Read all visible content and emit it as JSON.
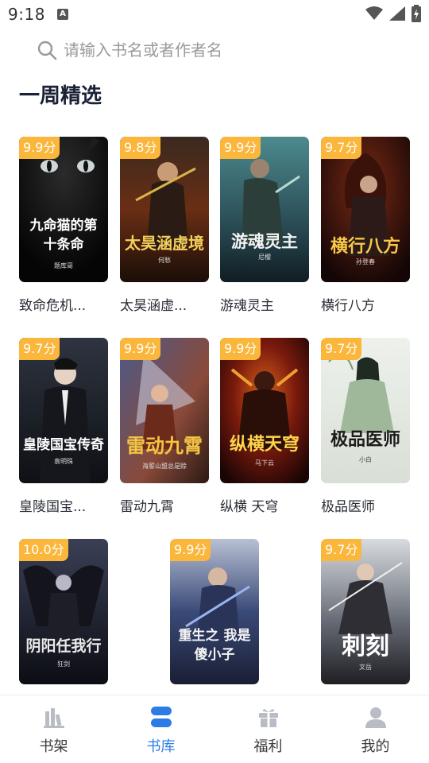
{
  "status": {
    "time": "9:18"
  },
  "search": {
    "placeholder": "请输入书名或者作者名"
  },
  "section": {
    "title": "一周精选"
  },
  "books": [
    {
      "title": "致命危机...",
      "score": "9.9分",
      "cover_title": "九命猫的第十条命",
      "cover_author": "题库哥"
    },
    {
      "title": "太昊涵虚...",
      "score": "9.8分",
      "cover_title": "太昊涵虚境",
      "cover_author": "何愁"
    },
    {
      "title": "游魂灵主",
      "score": "9.9分",
      "cover_title": "游魂灵主",
      "cover_author": "尼樱"
    },
    {
      "title": "横行八方",
      "score": "9.7分",
      "cover_title": "横行八方",
      "cover_author": "孙登春"
    },
    {
      "title": "皇陵国宝...",
      "score": "9.7分",
      "cover_title": "皇陵国宝传奇",
      "cover_author": "袁明珠"
    },
    {
      "title": "雷动九霄",
      "score": "9.9分",
      "cover_title": "雷动九霄",
      "cover_author": "海誓山盟总是赊"
    },
    {
      "title": "纵横 天穹",
      "score": "9.9分",
      "cover_title": "纵横天穹",
      "cover_author": "马下云"
    },
    {
      "title": "极品医师",
      "score": "9.7分",
      "cover_title": "极品医师",
      "cover_author": "小白"
    },
    {
      "title": "",
      "score": "10.0分",
      "cover_title": "阴阳任我行",
      "cover_author": "狂剑"
    },
    {
      "title": "",
      "score": "9.9分",
      "cover_title": "重生之 我是傻小子",
      "cover_author": ""
    },
    {
      "title": "",
      "score": "9.7分",
      "cover_title": "刺刻",
      "cover_author": "文岳"
    }
  ],
  "nav": [
    {
      "label": "书架",
      "icon": "bookshelf-icon",
      "active": false
    },
    {
      "label": "书库",
      "icon": "library-icon",
      "active": true
    },
    {
      "label": "福利",
      "icon": "gift-icon",
      "active": false
    },
    {
      "label": "我的",
      "icon": "profile-icon",
      "active": false
    }
  ],
  "colors": {
    "accent": "#2d7ce6",
    "badge": "#fbb63c"
  }
}
